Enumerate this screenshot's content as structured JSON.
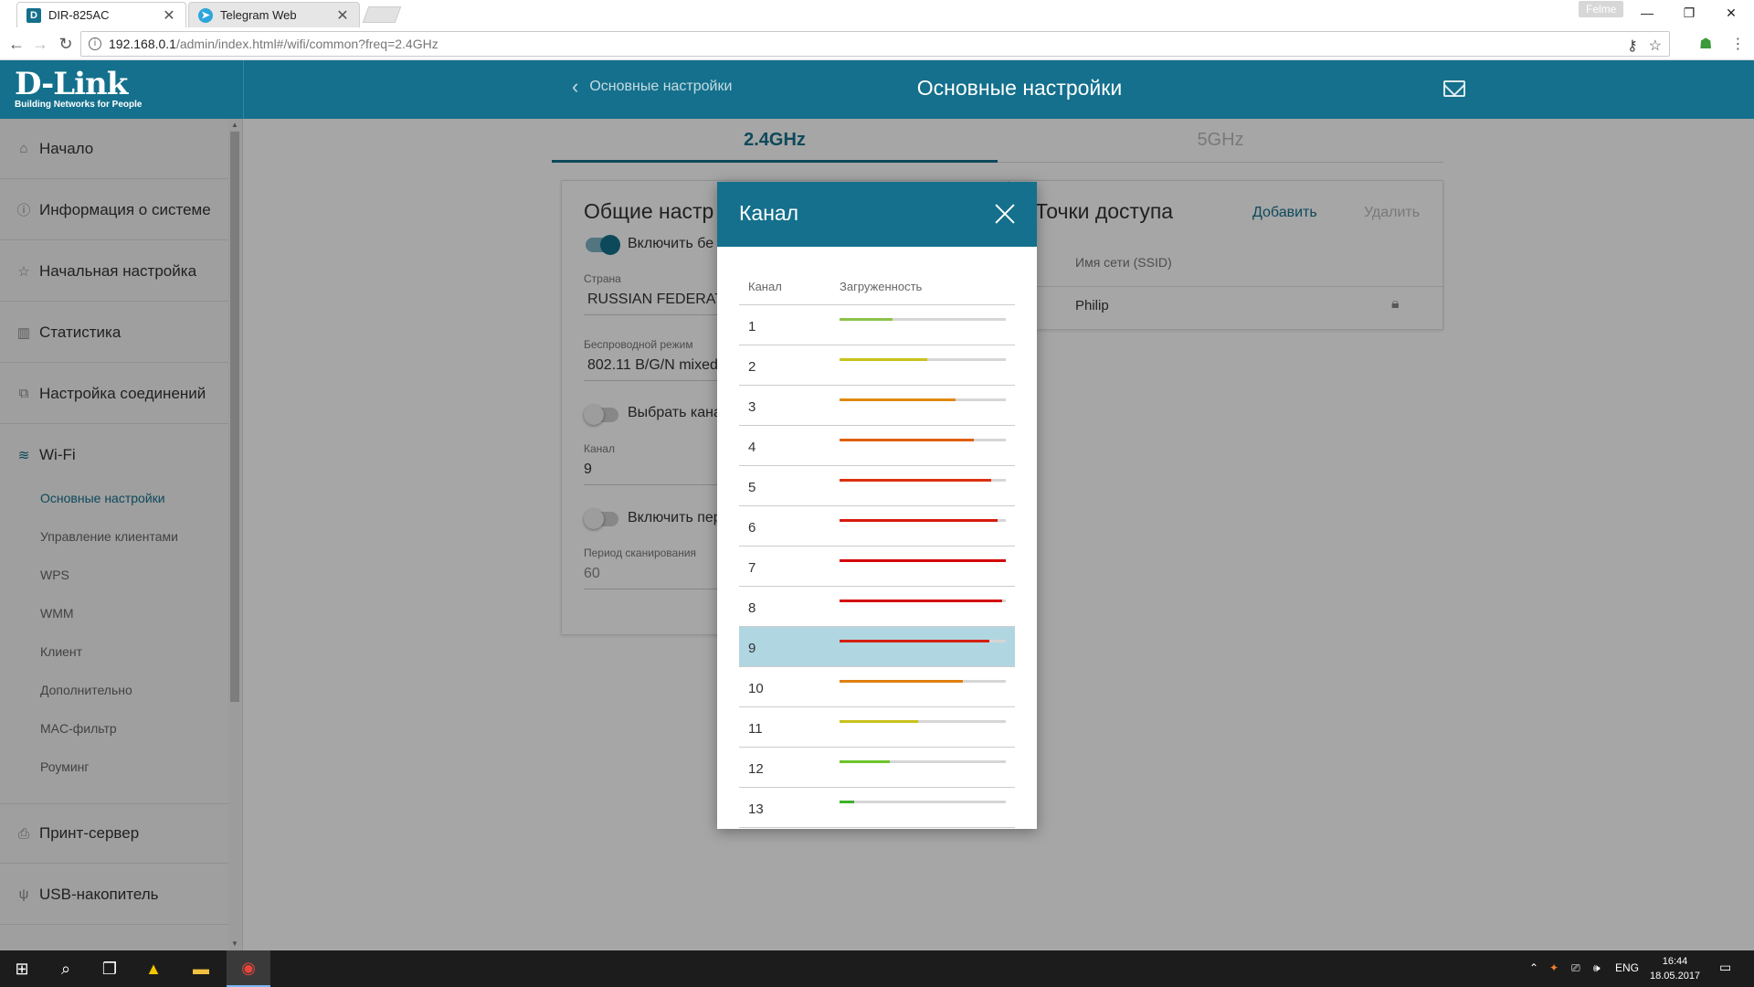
{
  "browser": {
    "tabs": [
      {
        "title": "DIR-825AC",
        "favicon": "dlink-icon",
        "active": true
      },
      {
        "title": "Telegram Web",
        "favicon": "telegram-icon",
        "active": false
      }
    ],
    "profile_name": "Felme",
    "url_host": "192.168.0.1",
    "url_path": "/admin/index.html#/wifi/common?freq=2.4GHz"
  },
  "header": {
    "logo_brand": "D-Link",
    "logo_tagline": "Building Networks for People",
    "back_label": "Основные настройки",
    "title": "Основные настройки"
  },
  "sidebar": {
    "items": [
      {
        "label": "Начало",
        "icon": "home-icon"
      },
      {
        "label": "Информация о системе",
        "icon": "info-icon"
      },
      {
        "label": "Начальная настройка",
        "icon": "star-icon"
      },
      {
        "label": "Статистика",
        "icon": "chart-icon"
      },
      {
        "label": "Настройка соединений",
        "icon": "connections-icon"
      },
      {
        "label": "Wi-Fi",
        "icon": "wifi-icon"
      },
      {
        "label": "Принт-сервер",
        "icon": "printer-icon"
      },
      {
        "label": "USB-накопитель",
        "icon": "usb-icon"
      }
    ],
    "wifi_subitems": [
      "Основные настройки",
      "Управление клиентами",
      "WPS",
      "WMM",
      "Клиент",
      "Дополнительно",
      "MAC-фильтр",
      "Роуминг"
    ]
  },
  "freq_tabs": [
    "2.4GHz",
    "5GHz"
  ],
  "general": {
    "title": "Общие настр",
    "enable_label": "Включить бе",
    "country_label": "Страна",
    "country_value": "RUSSIAN FEDERAT",
    "mode_label": "Беспроводной режим",
    "mode_value": "802.11 B/G/N mixed",
    "auto_channel_label": "Выбрать кана",
    "channel_label": "Канал",
    "channel_value": "9",
    "periodic_label": "Включить пер",
    "scan_period_label": "Период сканирования",
    "scan_period_value": "60"
  },
  "access_points": {
    "title": "Точки доступа",
    "add_label": "Добавить",
    "delete_label": "Удалить",
    "col_ssid": "Имя сети (SSID)",
    "rows": [
      {
        "ssid": "Philip"
      }
    ]
  },
  "modal": {
    "title": "Канал",
    "col_channel": "Канал",
    "col_load": "Загруженность",
    "selected_channel": 9,
    "channels": [
      {
        "num": "1",
        "load": 0.32,
        "color": "#8bc34a"
      },
      {
        "num": "2",
        "load": 0.53,
        "color": "#c8c21b"
      },
      {
        "num": "3",
        "load": 0.7,
        "color": "#e08a10"
      },
      {
        "num": "4",
        "load": 0.81,
        "color": "#e06010"
      },
      {
        "num": "5",
        "load": 0.91,
        "color": "#dc3010"
      },
      {
        "num": "6",
        "load": 0.95,
        "color": "#d81a0c"
      },
      {
        "num": "7",
        "load": 1.0,
        "color": "#d40808"
      },
      {
        "num": "8",
        "load": 0.98,
        "color": "#d40808"
      },
      {
        "num": "9",
        "load": 0.9,
        "color": "#d42010"
      },
      {
        "num": "10",
        "load": 0.74,
        "color": "#e08010"
      },
      {
        "num": "11",
        "load": 0.47,
        "color": "#c8c21b"
      },
      {
        "num": "12",
        "load": 0.3,
        "color": "#6cc42a"
      },
      {
        "num": "13",
        "load": 0.09,
        "color": "#3cb02a"
      }
    ]
  },
  "taskbar": {
    "language": "ENG",
    "time": "16:44",
    "date": "18.05.2017"
  },
  "colors": {
    "brand": "#14708c",
    "selected_row": "#b0d6e2"
  }
}
